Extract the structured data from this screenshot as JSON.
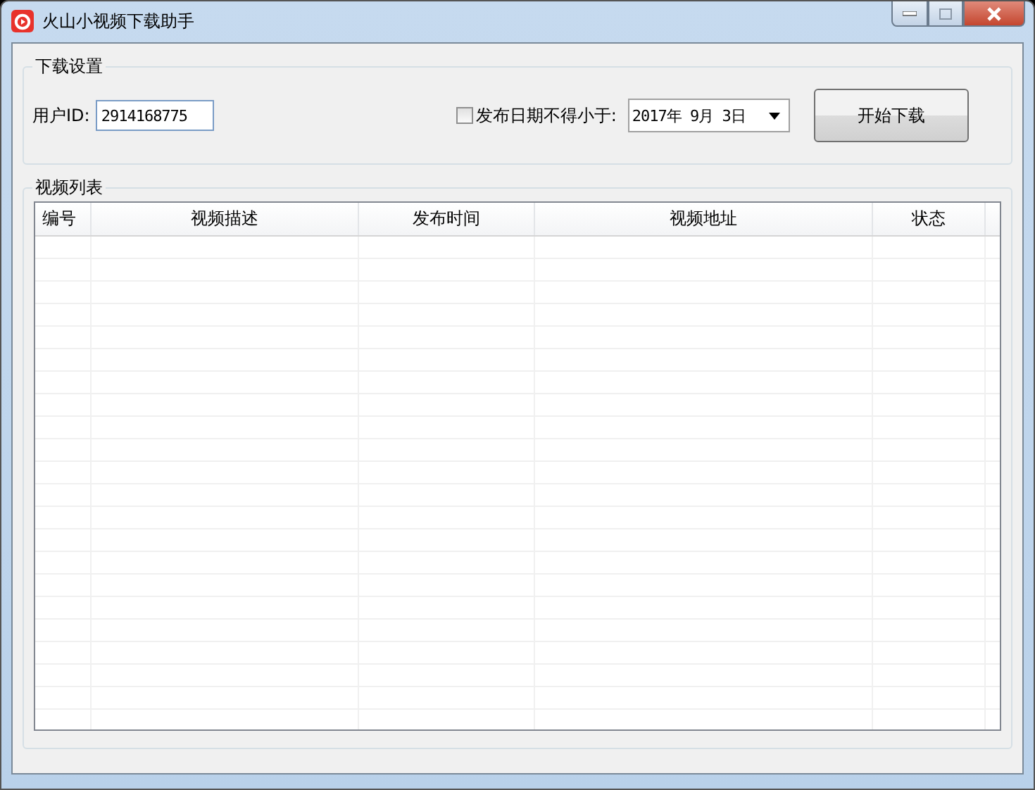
{
  "window": {
    "title": "火山小视频下载助手"
  },
  "settings": {
    "title": "下载设置",
    "user_id_label": "用户ID:",
    "user_id_value": "2914168775",
    "date_filter": {
      "label": "发布日期不得小于:",
      "checked": false
    },
    "date_value": "2017年 9月 3日",
    "start_button": "开始下载"
  },
  "video_list": {
    "title": "视频列表",
    "columns": [
      "编号",
      "视频描述",
      "发布时间",
      "视频地址",
      "状态"
    ]
  }
}
